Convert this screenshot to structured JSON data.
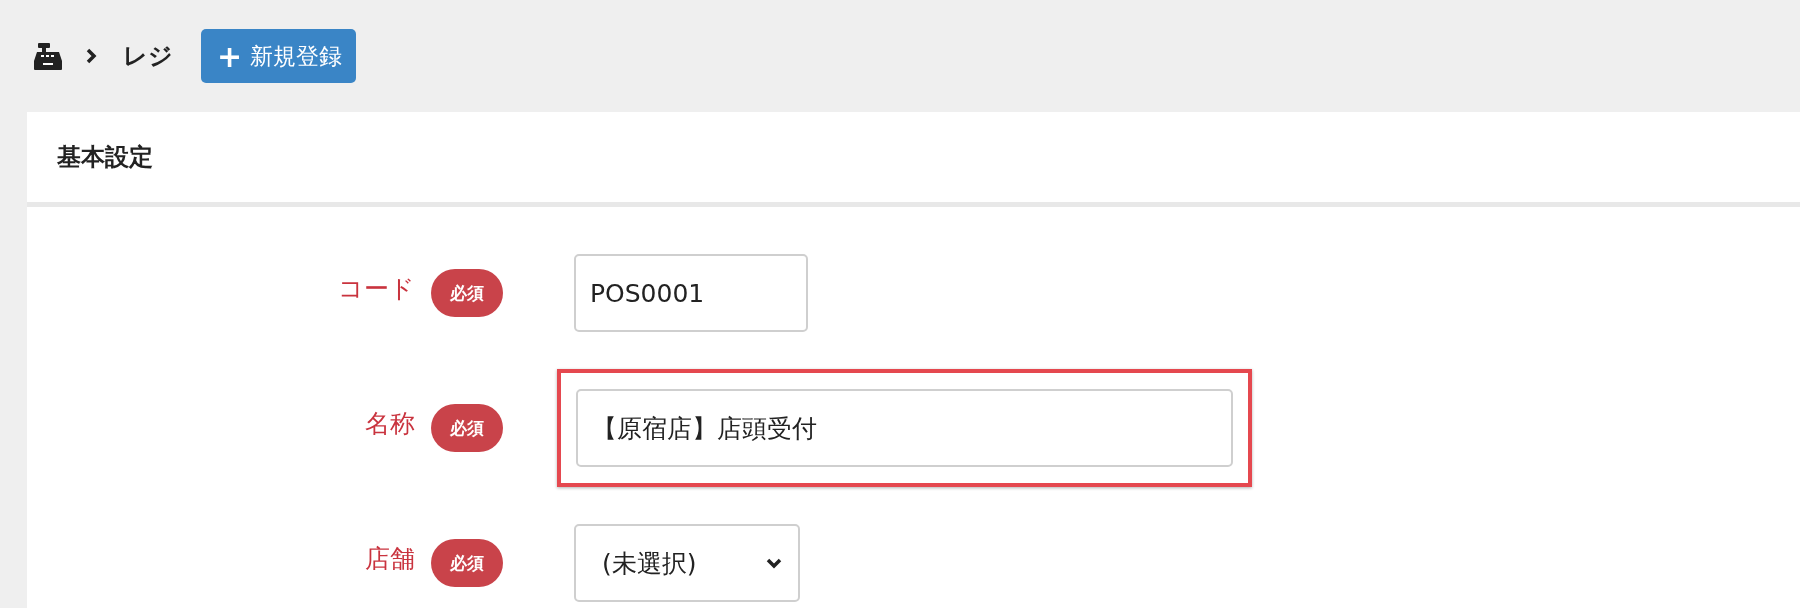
{
  "breadcrumb": {
    "current": "レジ"
  },
  "new_button": {
    "icon": "+",
    "label": "新規登録"
  },
  "section": {
    "title": "基本設定"
  },
  "fields": [
    {
      "kind": "text",
      "label": "コード",
      "badge": "必須",
      "value": "POS0001",
      "highlighted": false
    },
    {
      "kind": "text",
      "label": "名称",
      "badge": "必須",
      "value": "【原宿店】店頭受付",
      "highlighted": true
    },
    {
      "kind": "select",
      "label": "店舗",
      "badge": "必須",
      "value": "(未選択)",
      "highlighted": false
    }
  ]
}
